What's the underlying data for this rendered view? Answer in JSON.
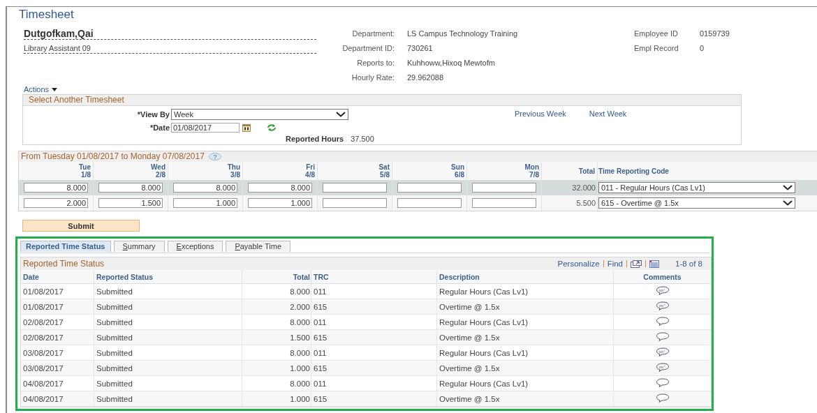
{
  "page": {
    "title": "Timesheet"
  },
  "employee": {
    "name": "Dutgofkam,Qai",
    "job_title": "Library Assistant 09",
    "details": [
      {
        "label": "Department:",
        "value": "LS Campus Technology Training"
      },
      {
        "label": "Department ID:",
        "value": "730261"
      },
      {
        "label": "Reports to:",
        "value": "Kuhhoww,Hixoq Mewtofm"
      },
      {
        "label": "Hourly Rate:",
        "value": "29.962088"
      }
    ],
    "ids": [
      {
        "label": "Employee ID",
        "value": "0159739"
      },
      {
        "label": "Empl Record",
        "value": "0"
      }
    ]
  },
  "actions_menu": {
    "label": "Actions"
  },
  "select_timesheet": {
    "title": "Select Another Timesheet",
    "view_by": {
      "label": "*View By",
      "value": "Week"
    },
    "date": {
      "label": "*Date",
      "value": "01/08/2017"
    },
    "reported_hours": {
      "label": "Reported Hours",
      "value": "37.500"
    },
    "links": [
      "Previous Week",
      "Next Week"
    ]
  },
  "week_grid": {
    "title": "From Tuesday 01/08/2017 to Monday 07/08/2017",
    "days": [
      {
        "day": "Tue",
        "date": "1/8"
      },
      {
        "day": "Wed",
        "date": "2/8"
      },
      {
        "day": "Thu",
        "date": "3/8"
      },
      {
        "day": "Fri",
        "date": "4/8"
      },
      {
        "day": "Sat",
        "date": "5/8"
      },
      {
        "day": "Sun",
        "date": "6/8"
      },
      {
        "day": "Mon",
        "date": "7/8"
      }
    ],
    "total_label": "Total",
    "trc_label": "Time Reporting Code",
    "help_icon": "?",
    "rows": [
      {
        "hours": [
          "8.000",
          "8.000",
          "8.000",
          "8.000"
        ],
        "total": "32.000",
        "trc": "011 - Regular Hours (Cas Lv1)"
      },
      {
        "hours": [
          "2.000",
          "1.500",
          "1.000",
          "1.000"
        ],
        "total": "5.500",
        "trc": "615 - Overtime @ 1.5x"
      }
    ]
  },
  "submit_button": {
    "label": "Submit"
  },
  "status_tabs": [
    {
      "label": "Reported Time Status",
      "selected": true
    },
    {
      "label": "Summary",
      "selected": false
    },
    {
      "label": "Exceptions",
      "selected": false
    },
    {
      "label": "Payable Time",
      "selected": false
    }
  ],
  "status_table": {
    "title": "Reported Time Status",
    "toolbar_links": [
      "Personalize",
      "Find"
    ],
    "count": "1-8 of 8",
    "columns": [
      "Date",
      "Reported Status",
      "Total",
      "TRC",
      "Description",
      "Comments"
    ],
    "rows": [
      {
        "date": "01/08/2017",
        "status": "Submitted",
        "total": "8.000",
        "trc": "011",
        "description": "Regular Hours (Cas Lv1)",
        "has_comment": true
      },
      {
        "date": "01/08/2017",
        "status": "Submitted",
        "total": "2.000",
        "trc": "615",
        "description": "Overtime @ 1.5x",
        "has_comment": true
      },
      {
        "date": "02/08/2017",
        "status": "Submitted",
        "total": "8.000",
        "trc": "011",
        "description": "Regular Hours (Cas Lv1)",
        "has_comment": false
      },
      {
        "date": "02/08/2017",
        "status": "Submitted",
        "total": "1.500",
        "trc": "615",
        "description": "Overtime @ 1.5x",
        "has_comment": false
      },
      {
        "date": "03/08/2017",
        "status": "Submitted",
        "total": "8.000",
        "trc": "011",
        "description": "Regular Hours (Cas Lv1)",
        "has_comment": true
      },
      {
        "date": "03/08/2017",
        "status": "Submitted",
        "total": "1.000",
        "trc": "615",
        "description": "Overtime @ 1.5x",
        "has_comment": true
      },
      {
        "date": "04/08/2017",
        "status": "Submitted",
        "total": "8.000",
        "trc": "011",
        "description": "Regular Hours (Cas Lv1)",
        "has_comment": false
      },
      {
        "date": "04/08/2017",
        "status": "Submitted",
        "total": "1.000",
        "trc": "615",
        "description": "Overtime @ 1.5x",
        "has_comment": false
      }
    ]
  }
}
